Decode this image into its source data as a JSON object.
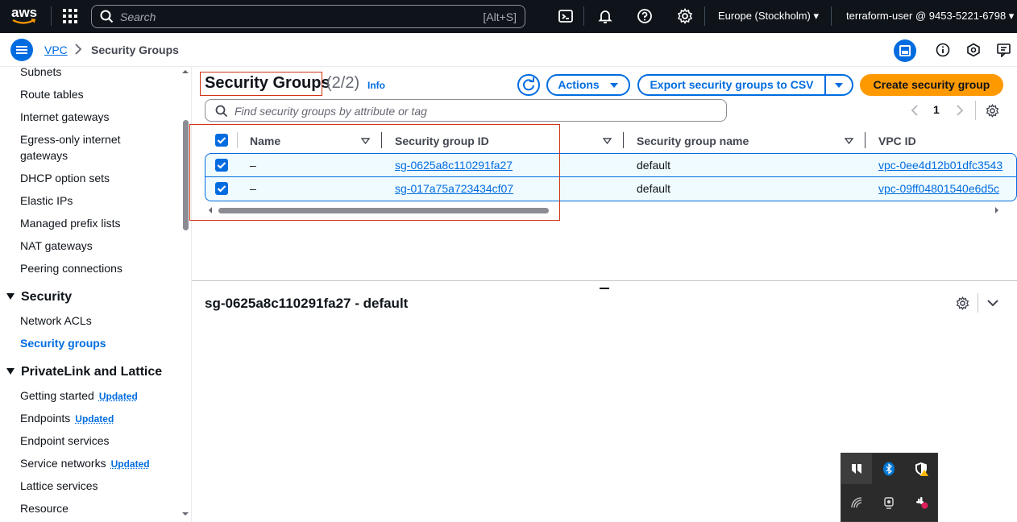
{
  "topbar": {
    "logo_text": "aws",
    "search_placeholder": "Search",
    "search_shortcut": "[Alt+S]",
    "region": "Europe (Stockholm) ▾",
    "account": "terraform-user @ 9453-5221-6798 ▾",
    "icons": [
      "services-grid-icon",
      "search-icon",
      "cloudshell-icon",
      "bell-icon",
      "help-icon",
      "settings-icon"
    ]
  },
  "breadcrumb": {
    "root": "VPC",
    "current": "Security Groups"
  },
  "sidebar": {
    "items_top": [
      "Subnets",
      "Route tables",
      "Internet gateways",
      "Egress-only internet",
      "gateways",
      "DHCP option sets",
      "Elastic IPs",
      "Managed prefix lists",
      "NAT gateways",
      "Peering connections"
    ],
    "security_header": "Security",
    "security_items": [
      "Network ACLs",
      "Security groups"
    ],
    "privatelink_header": "PrivateLink and Lattice",
    "privatelink_items": [
      {
        "label": "Getting started",
        "badge": "Updated"
      },
      {
        "label": "Endpoints",
        "badge": "Updated"
      },
      {
        "label": "Endpoint services",
        "badge": ""
      },
      {
        "label": "Service networks",
        "badge": "Updated"
      },
      {
        "label": "Lattice services",
        "badge": ""
      },
      {
        "label": "Resource",
        "badge": ""
      }
    ]
  },
  "main": {
    "title": "Security Groups",
    "count": "(2/2)",
    "info": "Info",
    "actions_label": "Actions",
    "export_label": "Export security groups to CSV",
    "create_label": "Create security group",
    "filter_placeholder": "Find security groups by attribute or tag",
    "page": "1",
    "columns": [
      "Name",
      "Security group ID",
      "Security group name",
      "VPC ID"
    ],
    "rows": [
      {
        "name": "–",
        "sg_id": "sg-0625a8c110291fa27",
        "sg_name": "default",
        "vpc_id": "vpc-0ee4d12b01dfc3543"
      },
      {
        "name": "–",
        "sg_id": "sg-017a75a723434cf07",
        "sg_name": "default",
        "vpc_id": "vpc-09ff04801540e6d5c"
      }
    ]
  },
  "detail": {
    "title": "sg-0625a8c110291fa27 - default"
  },
  "colors": {
    "accent": "#006ce0",
    "primary_button": "#ff9900",
    "topbar": "#0f141a",
    "annotation": "#d13212"
  }
}
